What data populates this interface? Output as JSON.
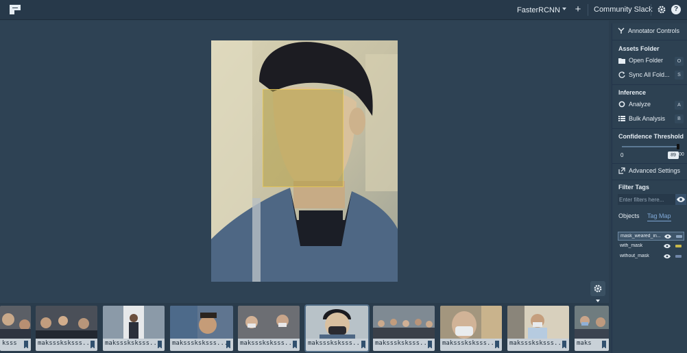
{
  "topbar": {
    "model": "FasterRCNN",
    "add": "+",
    "community_link": "Community Slack",
    "help": "?"
  },
  "panel": {
    "title": "Annotator Controls",
    "assets_title": "Assets Folder",
    "open_folder": "Open Folder",
    "open_folder_key": "O",
    "sync_folder": "Sync All Fold...",
    "sync_folder_key": "S",
    "inference_title": "Inference",
    "analyze": "Analyze",
    "analyze_key": "A",
    "bulk": "Bulk Analysis",
    "bulk_key": "B",
    "confidence_title": "Confidence Threshold",
    "confidence_min": "0",
    "confidence_value": "89",
    "confidence_max": "00",
    "confidence_fraction": 0.89,
    "advanced": "Advanced Settings",
    "filter_title": "Filter Tags",
    "filter_placeholder": "Enter filters here...",
    "tabs": [
      "Objects",
      "Tag Map"
    ],
    "tags": [
      {
        "name": "mask_weared_in...",
        "color": "#8aa2bd"
      },
      {
        "name": "with_mask",
        "color": "#c8b84a"
      },
      {
        "name": "without_mask",
        "color": "#6f86a8"
      }
    ]
  },
  "filmstrip": {
    "labels": [
      "ksss",
      "maksssksksss...",
      "maksssksksss...",
      "maksssksksss...",
      "maksssksksss...",
      "maksssksksss...",
      "maksssksksss...",
      "maksssksksss...",
      "maksssksksss...",
      "maks"
    ]
  },
  "colors": {
    "background": "#2b3e4f",
    "panel": "#2d4152",
    "bbox": "#b4a046",
    "accent": "#7fa8d6"
  }
}
